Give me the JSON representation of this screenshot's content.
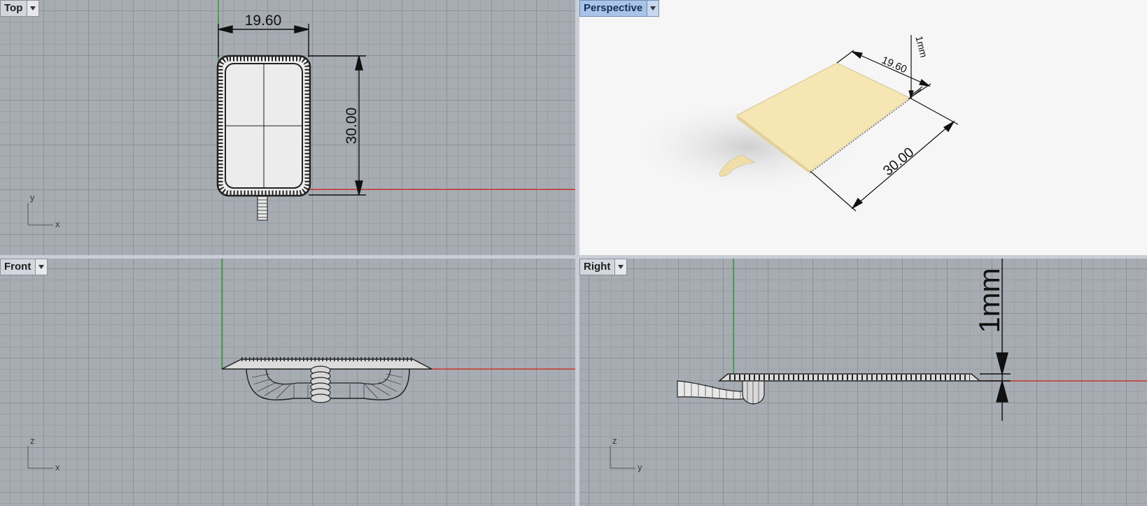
{
  "viewports": {
    "top": {
      "label": "Top",
      "axes": {
        "v": "y",
        "h": "x"
      }
    },
    "persp": {
      "label": "Perspective"
    },
    "front": {
      "label": "Front",
      "axes": {
        "v": "z",
        "h": "x"
      }
    },
    "right": {
      "label": "Right",
      "axes": {
        "v": "z",
        "h": "y"
      }
    }
  },
  "dimensions": {
    "width": "19.60",
    "length": "30.00",
    "thickness": "1mm"
  },
  "colors": {
    "x_axis": "#c8392b",
    "y_axis": "#2f9a3a",
    "part_fill_persp": "#f5e6b4",
    "part_fill_wire": "#e8e8e8"
  }
}
